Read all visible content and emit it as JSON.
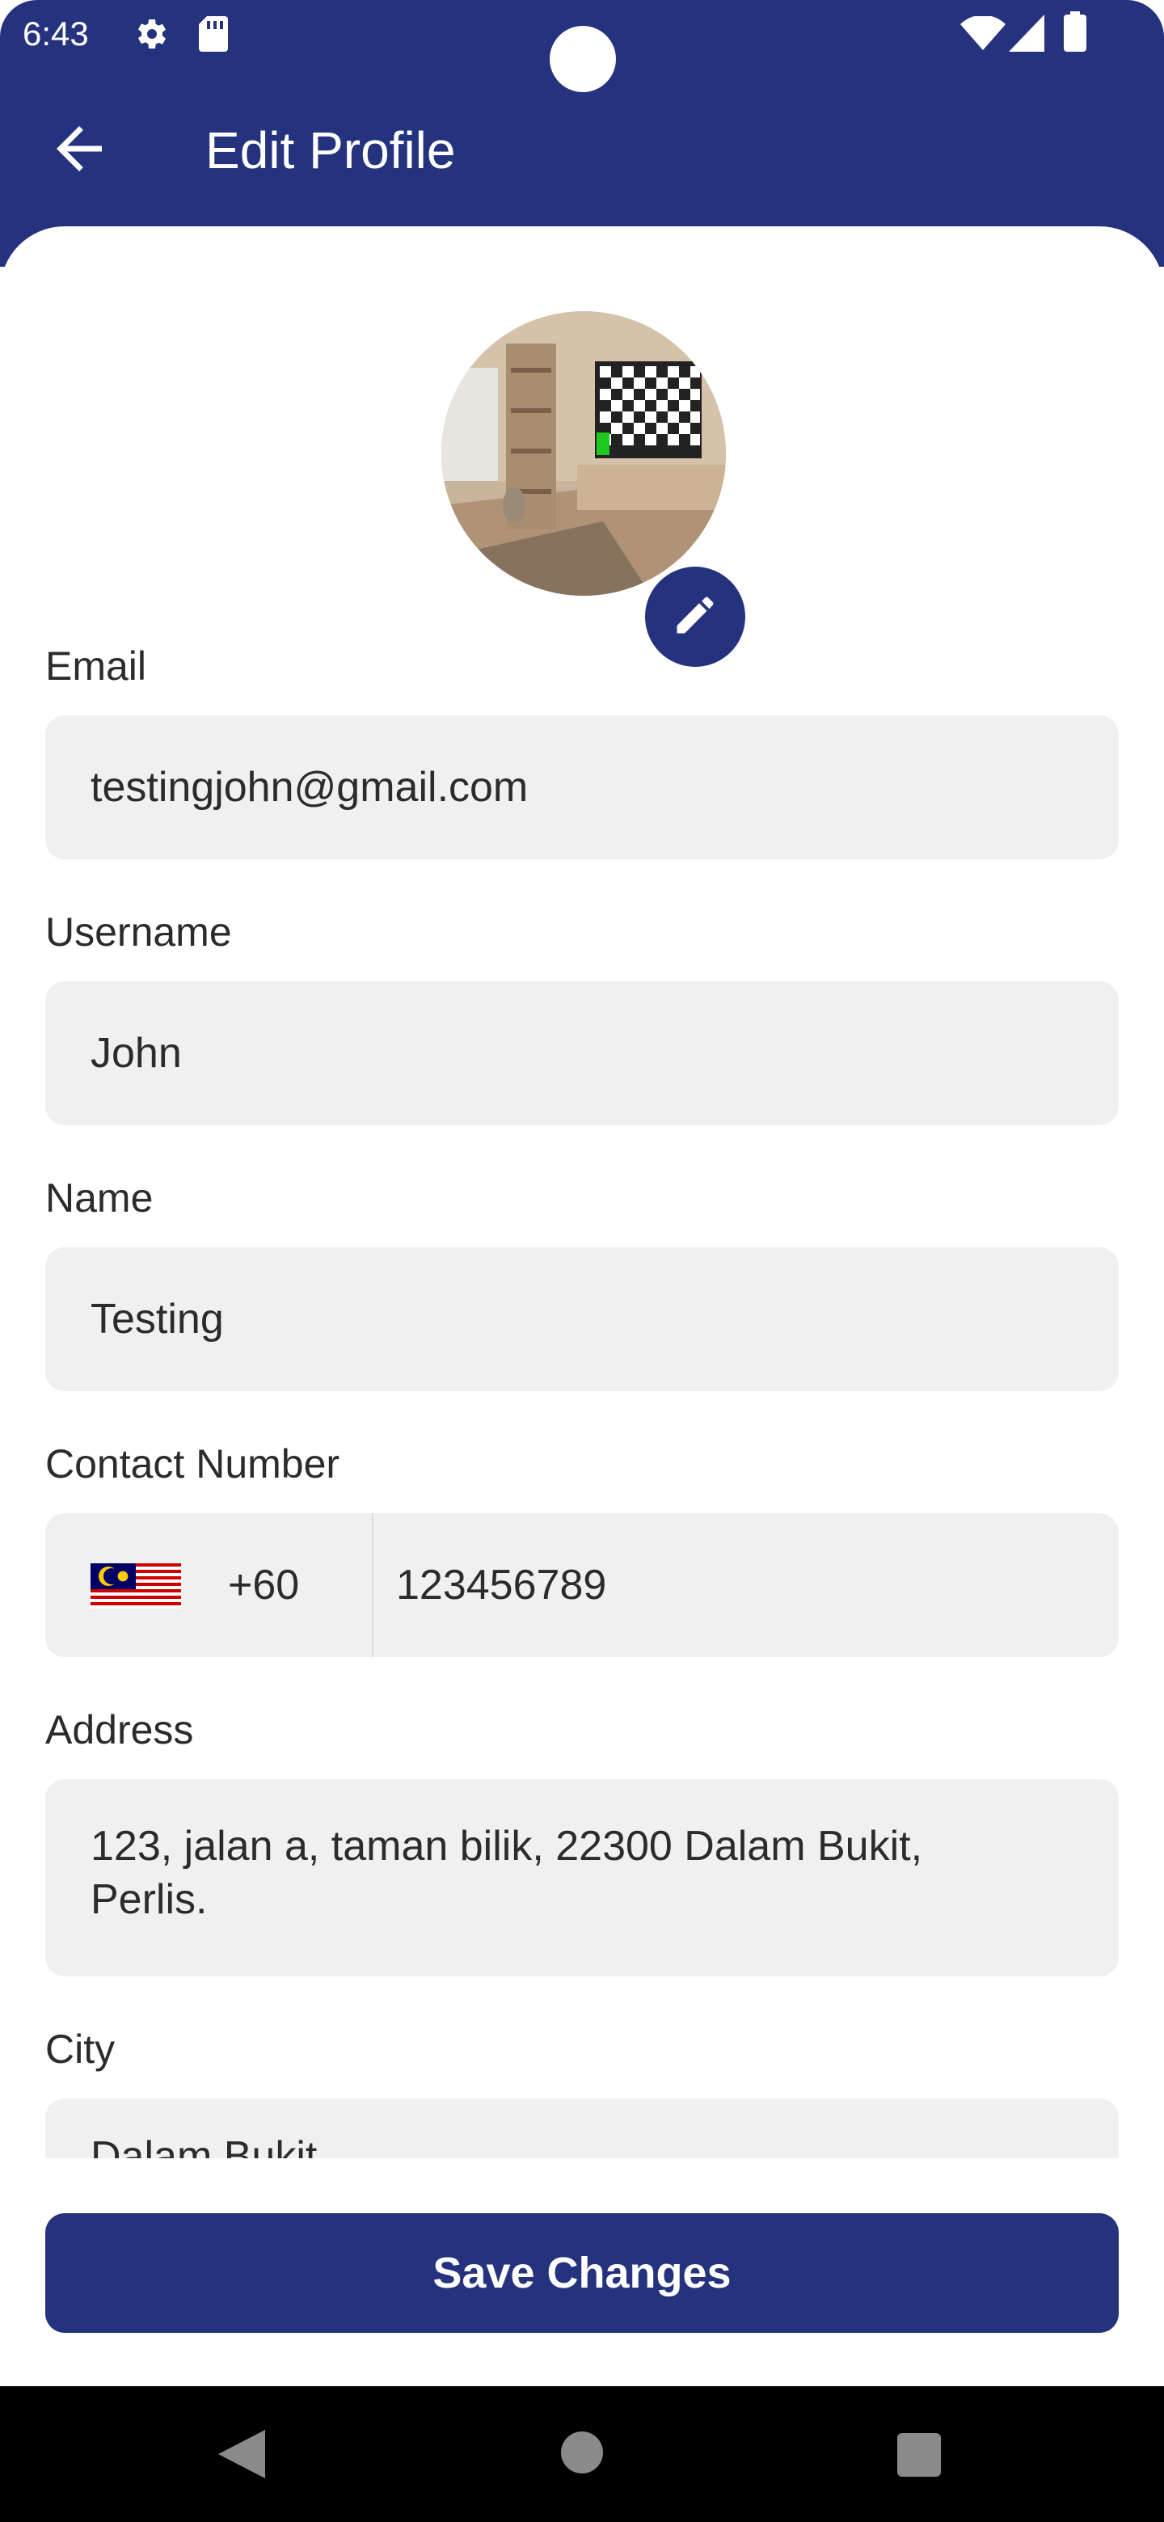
{
  "status_bar": {
    "time": "6:43",
    "icons": [
      "gear-icon",
      "sd-card-icon",
      "wifi-icon",
      "signal-icon",
      "battery-icon"
    ]
  },
  "app_bar": {
    "back_icon": "arrow-left-icon",
    "title": "Edit Profile"
  },
  "profile": {
    "edit_icon": "pencil-icon"
  },
  "form": {
    "email": {
      "label": "Email",
      "value": "testingjohn@gmail.com"
    },
    "username": {
      "label": "Username",
      "value": "John"
    },
    "name": {
      "label": "Name",
      "value": "Testing"
    },
    "contact": {
      "label": "Contact Number",
      "country_code": "+60",
      "flag_icon": "malaysia-flag-icon",
      "value": "123456789"
    },
    "address": {
      "label": "Address",
      "line1": "123, jalan a, taman bilik, 22300 Dalam Bukit,",
      "line2": "Perlis."
    },
    "city": {
      "label": "City",
      "value": "Dalam Bukit"
    }
  },
  "save_label": "Save Changes",
  "colors": {
    "primary": "#25337f",
    "field_bg": "#f0f0f0",
    "nav_bg": "#000000"
  },
  "nav_bar": {
    "icons": [
      "back-triangle-icon",
      "home-circle-icon",
      "recents-square-icon"
    ]
  }
}
